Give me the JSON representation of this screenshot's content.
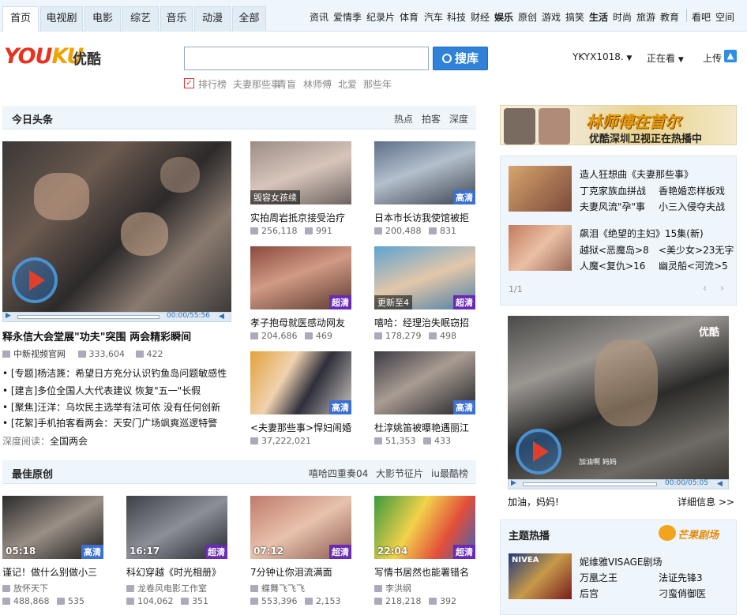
{
  "nav": {
    "tabs": [
      "首页",
      "电视剧",
      "电影",
      "综艺",
      "音乐",
      "动漫",
      "全部"
    ],
    "sub": [
      {
        "t": "资讯",
        "b": false
      },
      {
        "t": "爱情季",
        "b": false
      },
      {
        "t": "纪录片",
        "b": false
      },
      {
        "t": "体育",
        "b": false
      },
      {
        "t": "汽车",
        "b": false
      },
      {
        "t": "科技",
        "b": false
      },
      {
        "t": "财经",
        "b": false
      },
      {
        "t": "娱乐",
        "b": true
      },
      {
        "t": "原创",
        "b": false
      },
      {
        "t": "游戏",
        "b": false
      },
      {
        "t": "搞笑",
        "b": false
      },
      {
        "t": "生活",
        "b": true
      },
      {
        "t": "时尚",
        "b": false
      },
      {
        "t": "旅游",
        "b": false
      },
      {
        "t": "教育",
        "b": false
      },
      {
        "t": "看吧",
        "b": false
      },
      {
        "t": "空间",
        "b": false
      }
    ]
  },
  "header": {
    "logo_you": "YOU",
    "logo_ku": "KU",
    "logo_cn": "优酷",
    "search_button": "搜库",
    "user": "YKYX1018.",
    "watching": "正在看",
    "upload": "上传",
    "hot_tags": [
      "排行榜",
      "夫妻那些事",
      "青盲",
      "林师傅",
      "北爱",
      "那些年"
    ]
  },
  "headline": {
    "title": "今日头条",
    "links": [
      "热点",
      "拍客",
      "深度"
    ],
    "main": {
      "time": "00:00/55:56",
      "caption": "释永信大会堂展\"功夫\"突围 两会精彩瞬间",
      "uploader": "中新视频官网",
      "plays": "333,604",
      "comments": "422"
    },
    "list": [
      "• [专题]杨洁篪：希望日方充分认识钓鱼岛问题敏感性",
      "• [建言]多位全国人大代表建议 恢复\"五一\"长假",
      "• [聚焦]汪洋：乌坎民主选举有法可依 没有任何创新",
      "• [花絮]手机拍客看两会：天安门广场飒爽巡逻特警"
    ],
    "deep_label": "深度阅读：",
    "deep_value": "全国两会",
    "grid": [
      {
        "caption": "实拍周岩抵京接受治疗",
        "plays": "256,118",
        "comments": "991",
        "overlay": "毁容女孩续",
        "badge": ""
      },
      {
        "caption": "日本市长访我使馆被拒",
        "plays": "200,488",
        "comments": "831",
        "overlay": "",
        "badge": "高清"
      },
      {
        "caption": "孝子抱母就医感动网友",
        "plays": "204,686",
        "comments": "469",
        "overlay": "",
        "badge": "超清"
      },
      {
        "caption": "嘻哈：经理治失眠窃招",
        "plays": "178,279",
        "comments": "498",
        "overlay": "更新至4",
        "badge": "超清"
      },
      {
        "caption": "<夫妻那些事>悍妇闹婚",
        "plays": "37,222,021",
        "comments": "",
        "overlay": "",
        "badge": "高清"
      },
      {
        "caption": "杜淳姚笛被曝艳遇丽江",
        "plays": "51,353",
        "comments": "433",
        "overlay": "",
        "badge": "高清"
      }
    ]
  },
  "original": {
    "title": "最佳原创",
    "links": [
      "嘻哈四重奏04",
      "大影节征片",
      "iu最酷榜"
    ],
    "items": [
      {
        "dur": "05:18",
        "badge": "高清",
        "caption": "谨记！做什么别做小三",
        "uploader": "放怀天下",
        "plays": "488,868",
        "comments": "535"
      },
      {
        "dur": "16:17",
        "badge": "超清",
        "caption": "科幻穿越《时光相册》",
        "uploader": "龙卷风电影工作室",
        "plays": "104,062",
        "comments": "351"
      },
      {
        "dur": "07:12",
        "badge": "超清",
        "caption": "7分钟让你泪流满面",
        "uploader": "蝶舞飞飞飞",
        "plays": "553,396",
        "comments": "2,153"
      },
      {
        "dur": "22:04",
        "badge": "超清",
        "caption": "写情书居然也能署错名",
        "uploader": "李洪纲",
        "plays": "218,218",
        "comments": "392"
      }
    ]
  },
  "right": {
    "banner_text": "林师傅在首尔",
    "banner_sub": "优酷深圳卫视正在热播中",
    "promo1": {
      "title": "造人狂想曲《夫妻那些事》",
      "a": "丁克家族血拼战",
      "b": "香艳婚恋样板戏",
      "c": "夫妻风流\"孕\"事",
      "d": "小三入侵夺夫战"
    },
    "promo2": {
      "title": "飙泪《绝望的主妇》15集(新)",
      "a": "越狱<恶魔岛>8",
      "b": "<美少女>23无字",
      "c": "人魔<复仇>16",
      "d": "幽灵船<河流>5"
    },
    "pager": "1/1",
    "video": {
      "brand": "优酷",
      "subtitle": "加油啊 妈妈",
      "time": "00:00/05:05",
      "caption": "加油，妈妈!",
      "detail": "详细信息 >>"
    },
    "theme_title": "主题热播",
    "theme_logo": "芒果剧场",
    "theme": {
      "title": "妮维雅VISAGE剧场",
      "a": "万凰之王",
      "b": "法证先锋3",
      "c": "后宫",
      "d": "刁蛮俏御医"
    }
  }
}
